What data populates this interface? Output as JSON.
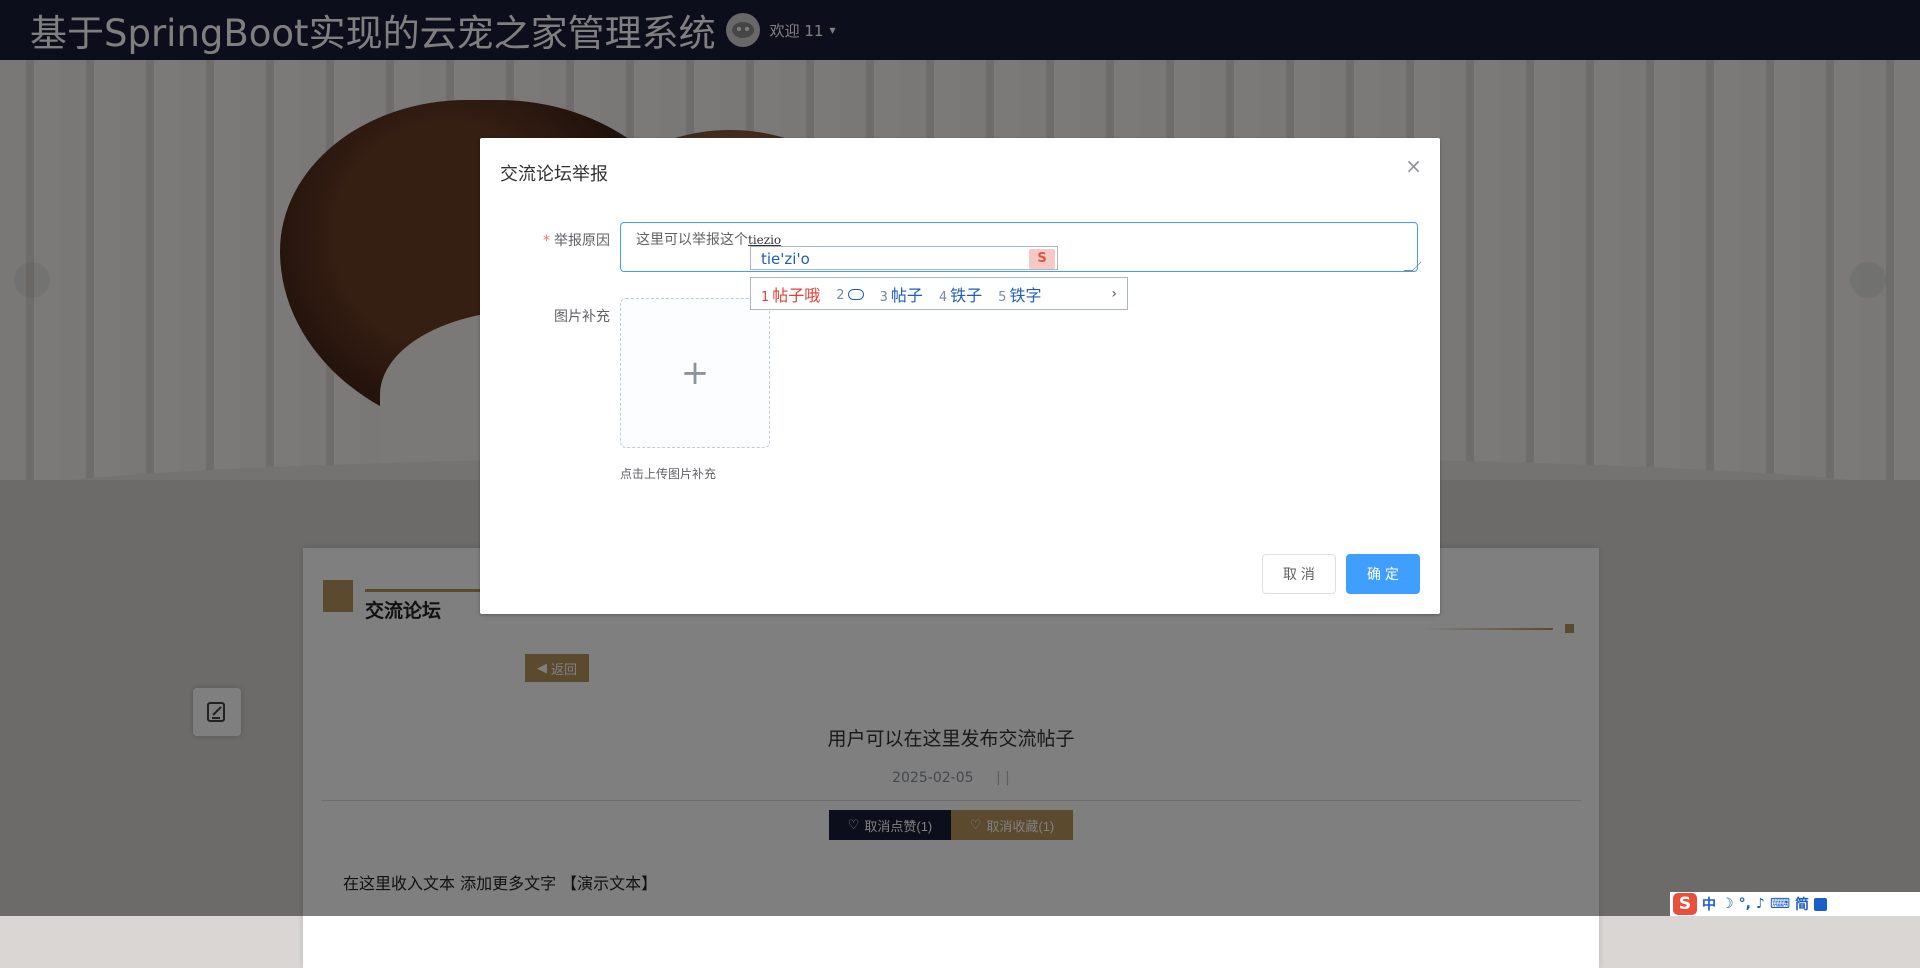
{
  "header": {
    "site_title": "基于SpringBoot实现的云宠之家管理系统",
    "welcome": "欢迎 11",
    "caret": "▾"
  },
  "section": {
    "title": "交流论坛",
    "back_label": "返回"
  },
  "post": {
    "title": "用户可以在这里发布交流帖子",
    "date": "2025-02-05",
    "meta_sep": "| |",
    "like_label": "取消点赞(1)",
    "fav_label": "取消收藏(1)",
    "body": "在这里收入文本 添加更多文字 【演示文本】"
  },
  "dialog": {
    "title": "交流论坛举报",
    "close": "×",
    "reason_label": "举报原因",
    "reason_text": "这里可以举报这个",
    "reason_pinyin": "tiezio",
    "image_label": "图片补充",
    "upload_plus": "+",
    "upload_tip": "点击上传图片补充",
    "cancel_label": "取 消",
    "confirm_label": "确 定"
  },
  "ime": {
    "composition": "tie'zi'o",
    "logo": "S",
    "candidates": [
      {
        "n": "1",
        "text": "帖子哦"
      },
      {
        "n": "2",
        "text": ""
      },
      {
        "n": "3",
        "text": "帖子"
      },
      {
        "n": "4",
        "text": "铁子"
      },
      {
        "n": "5",
        "text": "铁字"
      }
    ],
    "more": "›"
  },
  "sogou_bar": {
    "logo": "S",
    "items": [
      "中",
      "☽",
      "°,",
      "♪",
      "⌨",
      "简"
    ]
  },
  "colors": {
    "topbar": "#1b1d36",
    "accent_gold": "#b8945e",
    "primary_blue": "#409eff"
  }
}
